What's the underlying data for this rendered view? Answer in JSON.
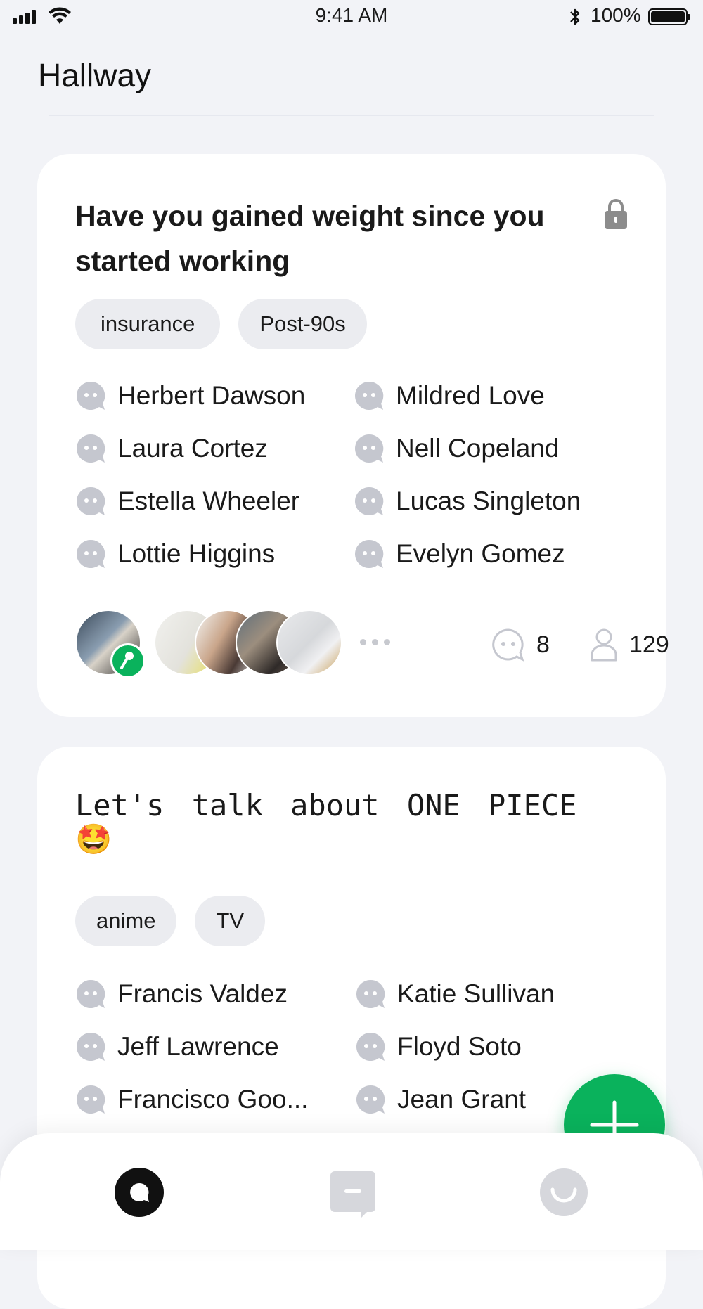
{
  "status": {
    "time": "9:41 AM",
    "battery": "100%"
  },
  "page": {
    "title": "Hallway"
  },
  "rooms": [
    {
      "title": "Have you gained weight since you started working",
      "locked": true,
      "tags": [
        "insurance",
        "Post-90s"
      ],
      "members": [
        "Herbert Dawson",
        "Mildred Love",
        "Laura Cortez",
        "Nell Copeland",
        "Estella Wheeler",
        "Lucas Singleton",
        "Lottie Higgins",
        "Evelyn Gomez"
      ],
      "message_count": "8",
      "listener_count": "129"
    },
    {
      "title": "Let's talk about ONE PIECE🤩",
      "tags": [
        "anime",
        "TV"
      ],
      "members": [
        "Francis Valdez",
        "Katie Sullivan",
        "Jeff Lawrence",
        "Floyd Soto",
        "Francisco Goo...",
        "Jean Grant"
      ]
    }
  ],
  "tab_bar": {
    "items": [
      "home-icon",
      "messages-icon",
      "profile-icon"
    ],
    "active": "home-icon"
  },
  "colors": {
    "accent": "#0ab25c",
    "background": "#f2f3f7",
    "tag_bg": "#ebecf0",
    "icon_gray": "#c5c7cf"
  },
  "icons": [
    "signal-icon",
    "wifi-icon",
    "bluetooth-icon",
    "battery-icon",
    "lock-icon",
    "member-chat-icon",
    "speaker-badge-icon",
    "chat-count-icon",
    "listener-count-icon",
    "add-icon"
  ]
}
